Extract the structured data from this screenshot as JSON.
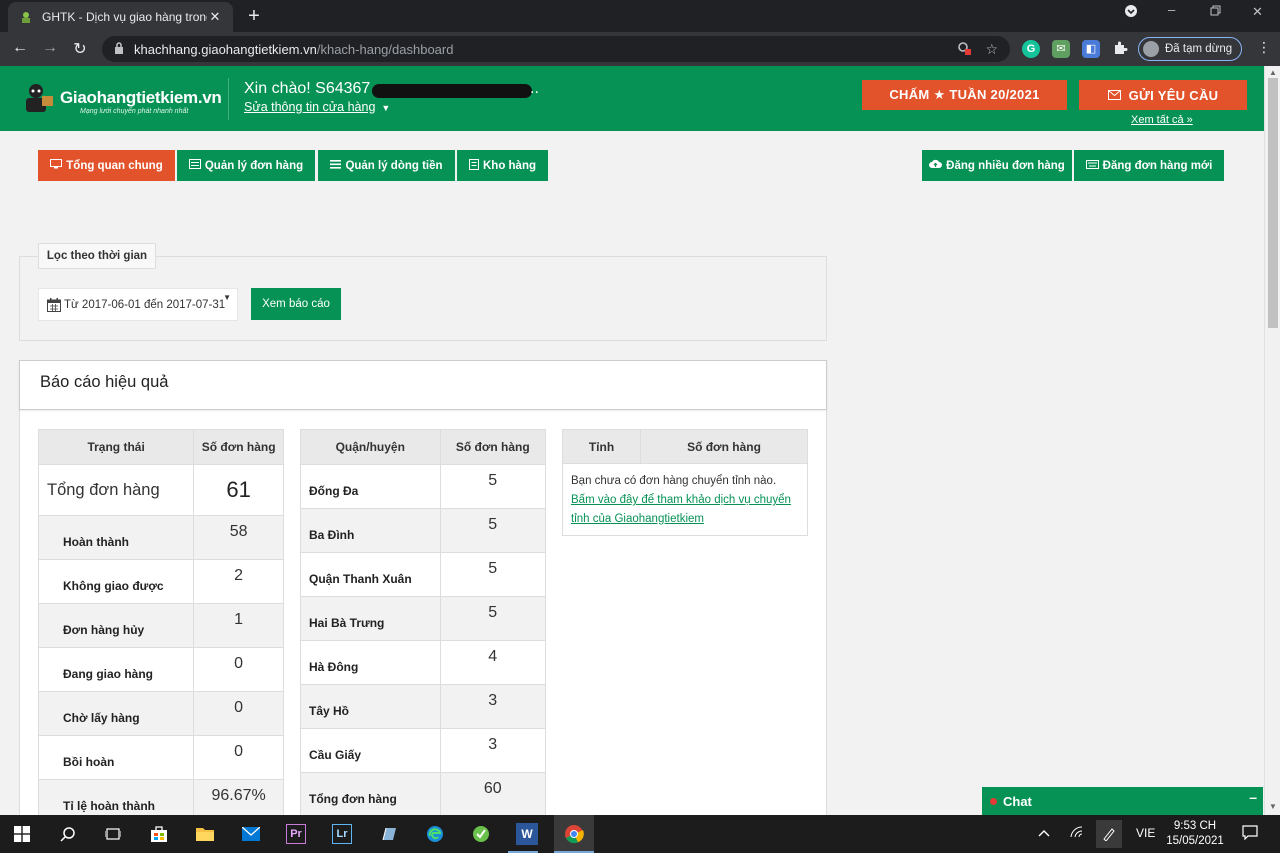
{
  "browser": {
    "tab_title": "GHTK - Dịch vụ giao hàng trong",
    "tab_close": "✕",
    "new_tab": "+",
    "url_host": "khachhang.giaohangtietkiem.vn",
    "url_path": "/khach-hang/dashboard",
    "profile_label": "Đã tạm dừng"
  },
  "header": {
    "brand": "Giaohangtietkiem.vn",
    "tagline": "Mạng lưới chuyển phát nhanh nhất",
    "greeting": "Xin chào! S64367 -",
    "greeting_tail": "..",
    "edit_shop": "Sửa thông tin cửa hàng",
    "week_button": "CHẤM ★ TUẦN 20/2021",
    "request_button": "GỬI YÊU CẦU",
    "see_all": "Xem tất cả »"
  },
  "menu": {
    "overview": "Tổng quan chung",
    "orders": "Quản lý đơn hàng",
    "cashflow": "Quản lý dòng tiền",
    "warehouse": "Kho hàng",
    "bulk_upload": "Đăng nhiều đơn hàng",
    "new_order": "Đăng đơn hàng mới"
  },
  "filter": {
    "legend": "Lọc theo thời gian",
    "date_range": "Từ 2017-06-01 đến 2017-07-31",
    "view_report": "Xem báo cáo"
  },
  "report": {
    "title": "Báo cáo hiệu quả",
    "status_table": {
      "col_status": "Trạng thái",
      "col_count": "Số đơn hàng",
      "total_label": "Tổng đơn hàng",
      "total_value": "61",
      "rows": [
        {
          "label": "Hoàn thành",
          "value": "58"
        },
        {
          "label": "Không giao được",
          "value": "2"
        },
        {
          "label": "Đơn hàng hủy",
          "value": "1"
        },
        {
          "label": "Đang giao hàng",
          "value": "0"
        },
        {
          "label": "Chờ lấy hàng",
          "value": "0"
        },
        {
          "label": "Bồi hoàn",
          "value": "0"
        },
        {
          "label": "Tỉ lệ hoàn thành",
          "value": "96.67%"
        }
      ]
    },
    "district_table": {
      "col_district": "Quận/huyện",
      "col_count": "Số đơn hàng",
      "rows": [
        {
          "label": "Đống Đa",
          "value": "5"
        },
        {
          "label": "Ba Đình",
          "value": "5"
        },
        {
          "label": "Quận Thanh Xuân",
          "value": "5"
        },
        {
          "label": "Hai Bà Trưng",
          "value": "5"
        },
        {
          "label": "Hà Đông",
          "value": "4"
        },
        {
          "label": "Tây Hồ",
          "value": "3"
        },
        {
          "label": "Cầu Giấy",
          "value": "3"
        },
        {
          "label": "Tổng đơn hàng",
          "value": "60"
        }
      ]
    },
    "province_table": {
      "col_province": "Tỉnh",
      "col_count": "Số đơn hàng",
      "empty_text": "Bạn chưa có đơn hàng chuyển tỉnh nào.",
      "link_text": "Bấm vào đây để tham khảo dịch vụ chuyển tỉnh của Giaohangtietkiem"
    }
  },
  "chat": {
    "label": "Chat",
    "minimize": "–"
  },
  "taskbar": {
    "lang": "VIE",
    "time": "9:53 CH",
    "date": "15/05/2021",
    "premiere_label": "Pr",
    "lightroom_label": "Lr",
    "word_label": "W"
  },
  "colors": {
    "brand_green": "#069255",
    "accent_orange": "#e2532c"
  }
}
